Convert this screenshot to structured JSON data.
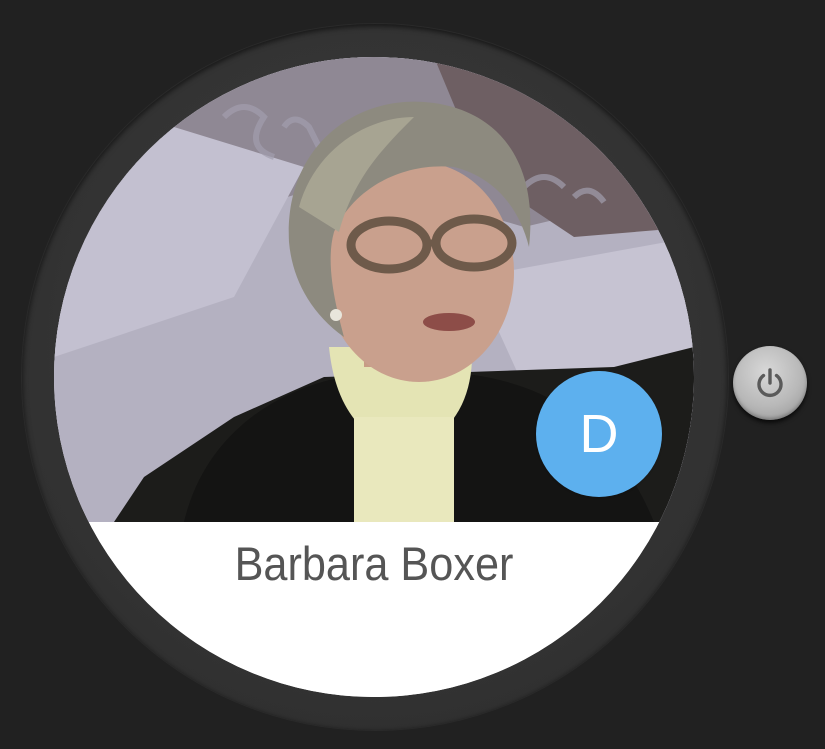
{
  "contact": {
    "name": "Barbara Boxer",
    "avatar_initial": "D"
  },
  "colors": {
    "background": "#212121",
    "bezel": "#333333",
    "avatar_badge": "#5db0ee",
    "name_text": "#555555"
  },
  "icons": {
    "power": "power-icon"
  }
}
